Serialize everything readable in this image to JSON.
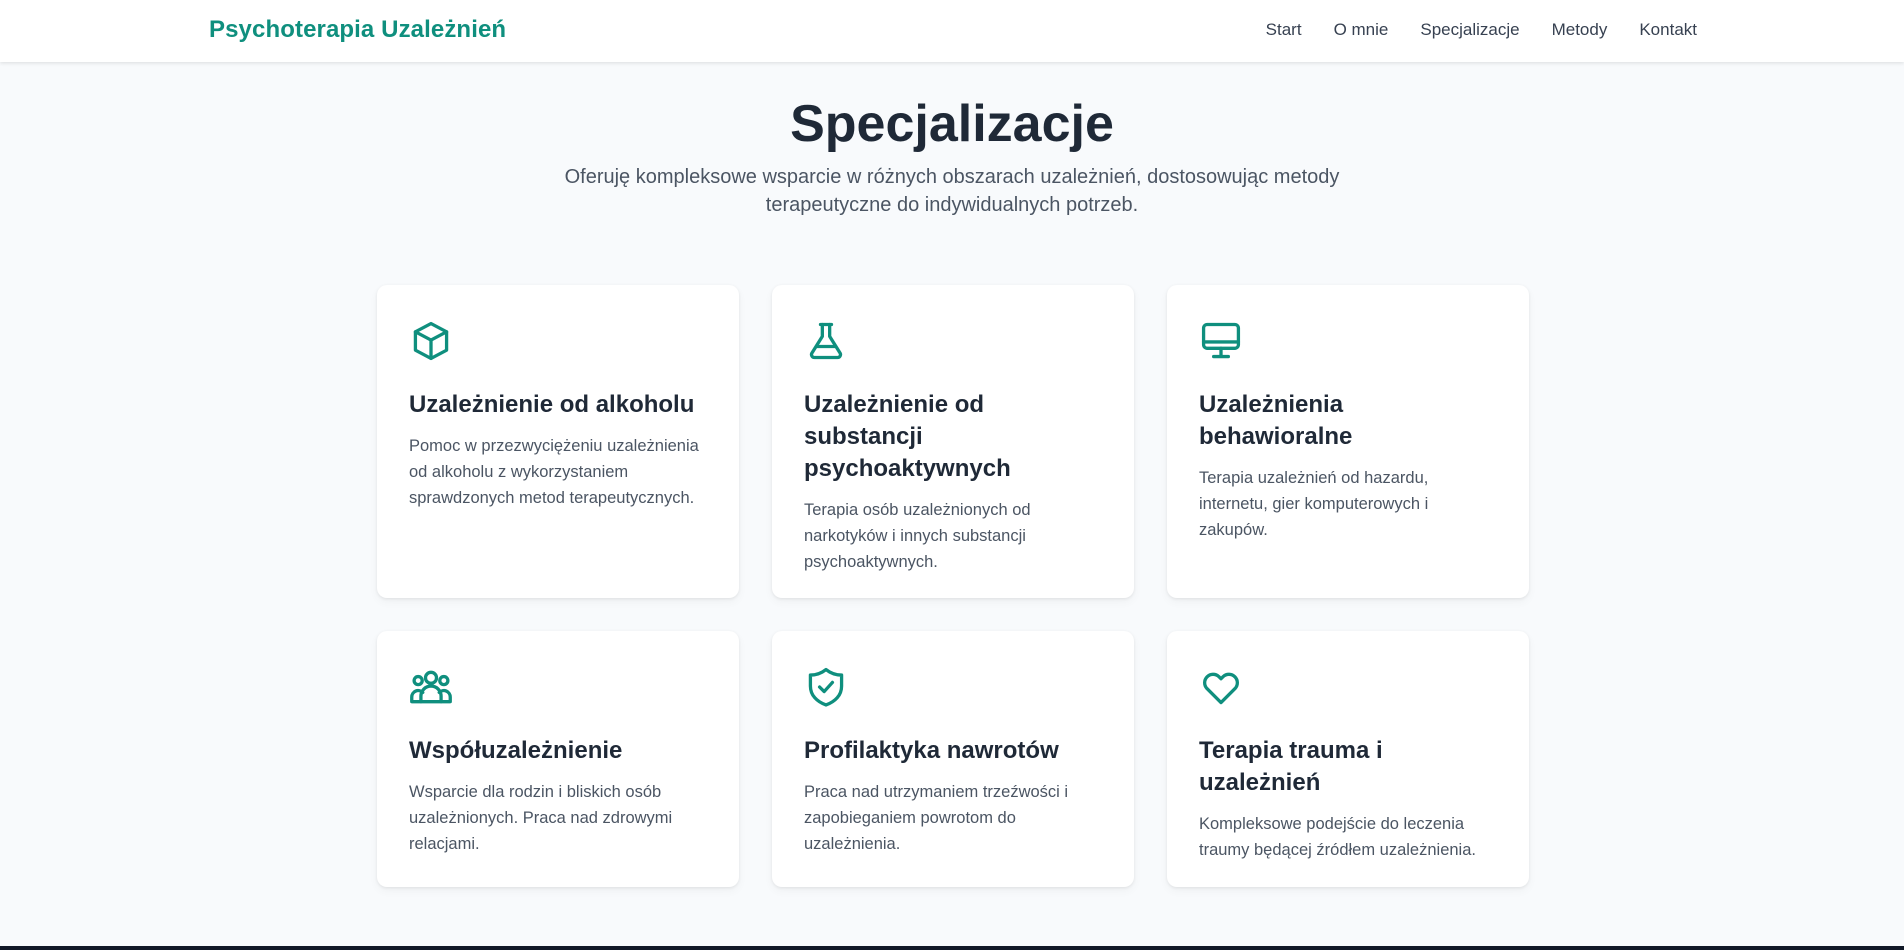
{
  "nav": {
    "brand": "Psychoterapia Uzależnień",
    "links": [
      "Start",
      "O mnie",
      "Specjalizacje",
      "Metody",
      "Kontakt"
    ]
  },
  "section": {
    "title": "Specjalizacje",
    "subtitle": "Oferuję kompleksowe wsparcie w różnych obszarach uzależnień, dostosowując metody terapeutyczne do indywidualnych potrzeb."
  },
  "cards": [
    {
      "icon": "cube-icon",
      "title": "Uzależnienie od alkoholu",
      "description": "Pomoc w przezwyciężeniu uzależnienia od alkoholu z wykorzystaniem sprawdzonych metod terapeutycznych."
    },
    {
      "icon": "flask-icon",
      "title": "Uzależnienie od substancji psychoaktywnych",
      "description": "Terapia osób uzależnionych od narkotyków i innych substancji psychoaktywnych."
    },
    {
      "icon": "monitor-icon",
      "title": "Uzależnienia behawioralne",
      "description": "Terapia uzależnień od hazardu, internetu, gier komputerowych i zakupów."
    },
    {
      "icon": "users-icon",
      "title": "Współuzależnienie",
      "description": "Wsparcie dla rodzin i bliskich osób uzależnionych. Praca nad zdrowymi relacjami."
    },
    {
      "icon": "shield-check-icon",
      "title": "Profilaktyka nawrotów",
      "description": "Praca nad utrzymaniem trzeźwości i zapobieganiem powrotom do uzależnienia."
    },
    {
      "icon": "heart-icon",
      "title": "Terapia trauma i uzależnień",
      "description": "Kompleksowe podejście do leczenia traumy będącej źródłem uzależnienia."
    }
  ],
  "colors": {
    "accent": "#0f8f7e",
    "background": "#f8fafc",
    "heading": "#1f2937",
    "body_text": "#4b5563"
  }
}
